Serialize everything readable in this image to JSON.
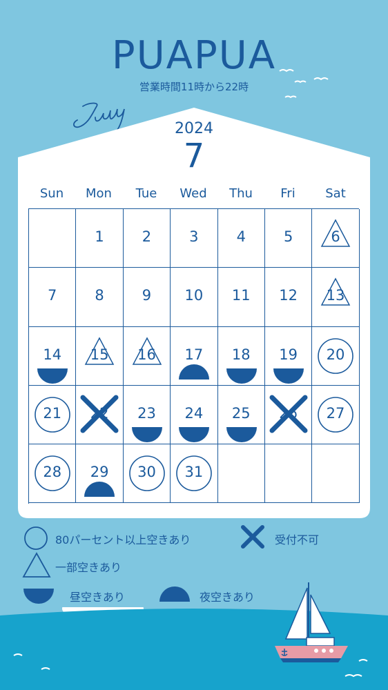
{
  "header": {
    "title": "PUAPUA",
    "hours": "営業時間11時から22時",
    "month_script": "July"
  },
  "calendar": {
    "year": "2024",
    "month": "7",
    "weekdays": [
      "Sun",
      "Mon",
      "Tue",
      "Wed",
      "Thu",
      "Fri",
      "Sat"
    ],
    "cells": [
      {
        "day": "",
        "status": "none"
      },
      {
        "day": "1",
        "status": "none"
      },
      {
        "day": "2",
        "status": "none"
      },
      {
        "day": "3",
        "status": "none"
      },
      {
        "day": "4",
        "status": "none"
      },
      {
        "day": "5",
        "status": "none"
      },
      {
        "day": "6",
        "status": "partial"
      },
      {
        "day": "7",
        "status": "none"
      },
      {
        "day": "8",
        "status": "none"
      },
      {
        "day": "9",
        "status": "none"
      },
      {
        "day": "10",
        "status": "none"
      },
      {
        "day": "11",
        "status": "none"
      },
      {
        "day": "12",
        "status": "none"
      },
      {
        "day": "13",
        "status": "partial"
      },
      {
        "day": "14",
        "status": "lunch"
      },
      {
        "day": "15",
        "status": "partial"
      },
      {
        "day": "16",
        "status": "partial"
      },
      {
        "day": "17",
        "status": "night"
      },
      {
        "day": "18",
        "status": "lunch"
      },
      {
        "day": "19",
        "status": "lunch"
      },
      {
        "day": "20",
        "status": "available"
      },
      {
        "day": "21",
        "status": "available"
      },
      {
        "day": "22",
        "status": "closed"
      },
      {
        "day": "23",
        "status": "lunch"
      },
      {
        "day": "24",
        "status": "lunch"
      },
      {
        "day": "25",
        "status": "lunch"
      },
      {
        "day": "26",
        "status": "closed"
      },
      {
        "day": "27",
        "status": "available"
      },
      {
        "day": "28",
        "status": "available"
      },
      {
        "day": "29",
        "status": "night"
      },
      {
        "day": "30",
        "status": "available"
      },
      {
        "day": "31",
        "status": "available"
      },
      {
        "day": "",
        "status": "none"
      },
      {
        "day": "",
        "status": "none"
      },
      {
        "day": "",
        "status": "none"
      }
    ]
  },
  "legend": {
    "available": "80パーセント以上空きあり",
    "closed": "受付不可",
    "partial": "一部空きあり",
    "lunch": "昼空きあり",
    "night": "夜空きあり"
  },
  "colors": {
    "background": "#7fc6e0",
    "primary": "#1b5a9c",
    "card": "#ffffff",
    "sea": "#17a3cc"
  }
}
